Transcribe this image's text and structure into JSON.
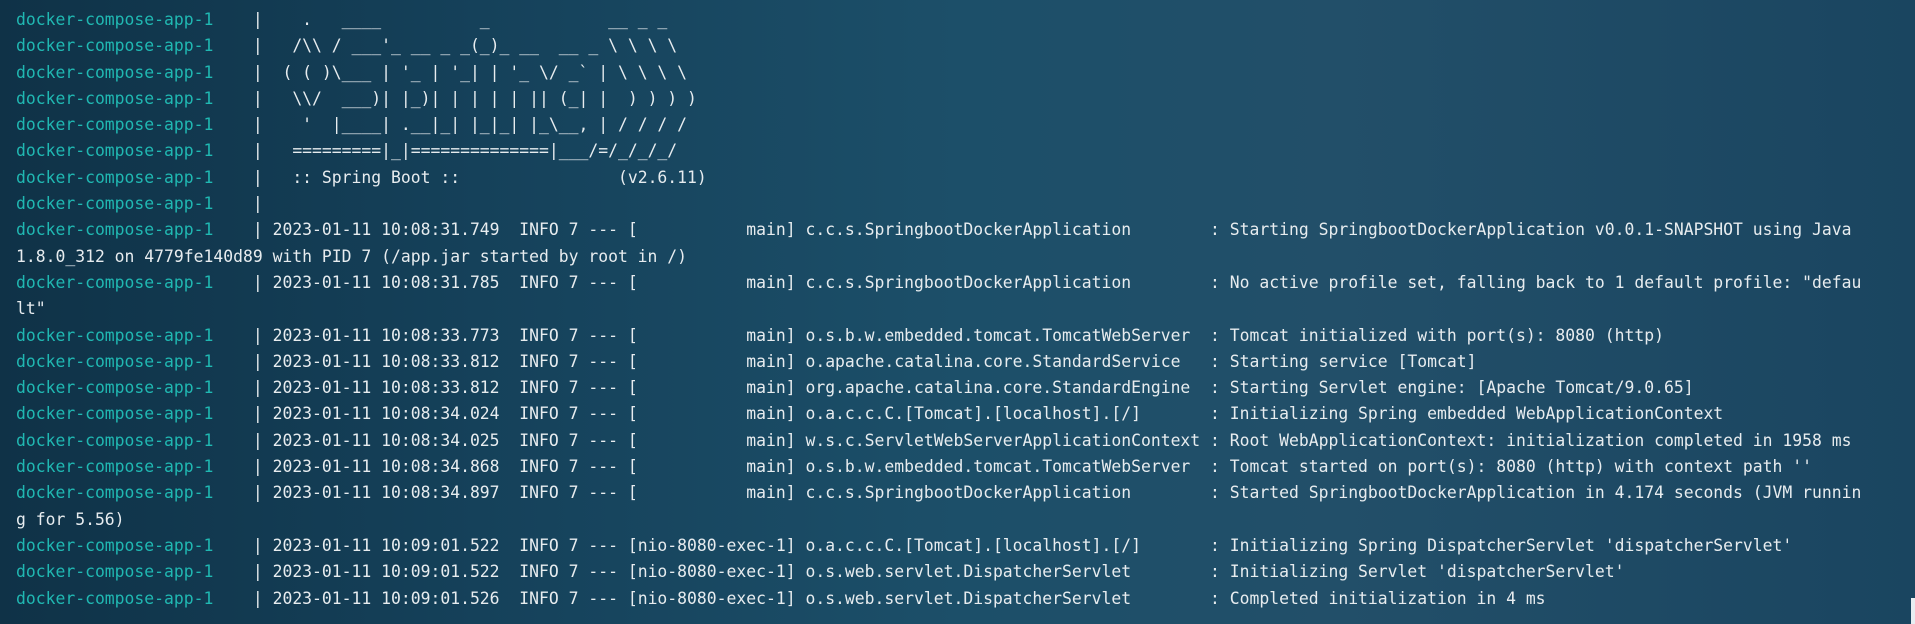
{
  "terminal": {
    "lines": [
      {
        "prefix": "docker-compose-app-1    ",
        "body": "|    .   ____          _            __ _ _"
      },
      {
        "prefix": "docker-compose-app-1    ",
        "body": "|   /\\\\ / ___'_ __ _ _(_)_ __  __ _ \\ \\ \\ \\"
      },
      {
        "prefix": "docker-compose-app-1    ",
        "body": "|  ( ( )\\___ | '_ | '_| | '_ \\/ _` | \\ \\ \\ \\"
      },
      {
        "prefix": "docker-compose-app-1    ",
        "body": "|   \\\\/  ___)| |_)| | | | | || (_| |  ) ) ) )"
      },
      {
        "prefix": "docker-compose-app-1    ",
        "body": "|    '  |____| .__|_| |_|_| |_\\__, | / / / /"
      },
      {
        "prefix": "docker-compose-app-1    ",
        "body": "|   =========|_|==============|___/=/_/_/_/"
      },
      {
        "prefix": "docker-compose-app-1    ",
        "body": "|   :: Spring Boot ::                (v2.6.11)"
      },
      {
        "prefix": "docker-compose-app-1    ",
        "body": "|"
      },
      {
        "prefix": "docker-compose-app-1    ",
        "body": "| 2023-01-11 10:08:31.749  INFO 7 --- [           main] c.c.s.SpringbootDockerApplication        : Starting SpringbootDockerApplication v0.0.1-SNAPSHOT using Java"
      },
      {
        "prefix": "",
        "body": "1.8.0_312 on 4779fe140d89 with PID 7 (/app.jar started by root in /)"
      },
      {
        "prefix": "docker-compose-app-1    ",
        "body": "| 2023-01-11 10:08:31.785  INFO 7 --- [           main] c.c.s.SpringbootDockerApplication        : No active profile set, falling back to 1 default profile: \"defau"
      },
      {
        "prefix": "",
        "body": "lt\""
      },
      {
        "prefix": "docker-compose-app-1    ",
        "body": "| 2023-01-11 10:08:33.773  INFO 7 --- [           main] o.s.b.w.embedded.tomcat.TomcatWebServer  : Tomcat initialized with port(s): 8080 (http)"
      },
      {
        "prefix": "docker-compose-app-1    ",
        "body": "| 2023-01-11 10:08:33.812  INFO 7 --- [           main] o.apache.catalina.core.StandardService   : Starting service [Tomcat]"
      },
      {
        "prefix": "docker-compose-app-1    ",
        "body": "| 2023-01-11 10:08:33.812  INFO 7 --- [           main] org.apache.catalina.core.StandardEngine  : Starting Servlet engine: [Apache Tomcat/9.0.65]"
      },
      {
        "prefix": "docker-compose-app-1    ",
        "body": "| 2023-01-11 10:08:34.024  INFO 7 --- [           main] o.a.c.c.C.[Tomcat].[localhost].[/]       : Initializing Spring embedded WebApplicationContext"
      },
      {
        "prefix": "docker-compose-app-1    ",
        "body": "| 2023-01-11 10:08:34.025  INFO 7 --- [           main] w.s.c.ServletWebServerApplicationContext : Root WebApplicationContext: initialization completed in 1958 ms"
      },
      {
        "prefix": "docker-compose-app-1    ",
        "body": "| 2023-01-11 10:08:34.868  INFO 7 --- [           main] o.s.b.w.embedded.tomcat.TomcatWebServer  : Tomcat started on port(s): 8080 (http) with context path ''"
      },
      {
        "prefix": "docker-compose-app-1    ",
        "body": "| 2023-01-11 10:08:34.897  INFO 7 --- [           main] c.c.s.SpringbootDockerApplication        : Started SpringbootDockerApplication in 4.174 seconds (JVM runnin"
      },
      {
        "prefix": "",
        "body": "g for 5.56)"
      },
      {
        "prefix": "docker-compose-app-1    ",
        "body": "| 2023-01-11 10:09:01.522  INFO 7 --- [nio-8080-exec-1] o.a.c.c.C.[Tomcat].[localhost].[/]       : Initializing Spring DispatcherServlet 'dispatcherServlet'"
      },
      {
        "prefix": "docker-compose-app-1    ",
        "body": "| 2023-01-11 10:09:01.522  INFO 7 --- [nio-8080-exec-1] o.s.web.servlet.DispatcherServlet        : Initializing Servlet 'dispatcherServlet'"
      },
      {
        "prefix": "docker-compose-app-1    ",
        "body": "| 2023-01-11 10:09:01.526  INFO 7 --- [nio-8080-exec-1] o.s.web.servlet.DispatcherServlet        : Completed initialization in 4 ms"
      }
    ]
  }
}
